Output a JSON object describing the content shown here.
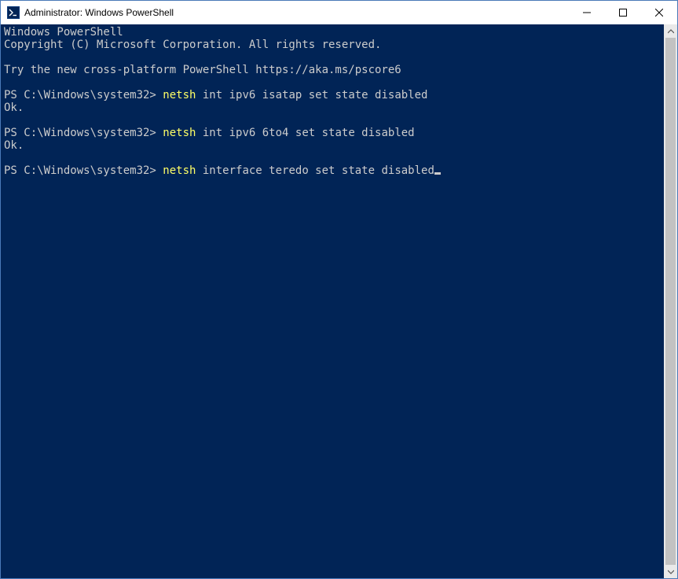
{
  "window": {
    "title": "Administrator: Windows PowerShell"
  },
  "terminal": {
    "header1": "Windows PowerShell",
    "header2": "Copyright (C) Microsoft Corporation. All rights reserved.",
    "tip": "Try the new cross-platform PowerShell https://aka.ms/pscore6",
    "prompt": "PS C:\\Windows\\system32> ",
    "ok": "Ok.",
    "cmd1_kw": "netsh",
    "cmd1_rest": " int ipv6 isatap set state disabled",
    "cmd2_kw": "netsh",
    "cmd2_rest": " int ipv6 6to4 set state disabled",
    "cmd3_kw": "netsh",
    "cmd3_rest": " interface teredo set state disabled"
  }
}
